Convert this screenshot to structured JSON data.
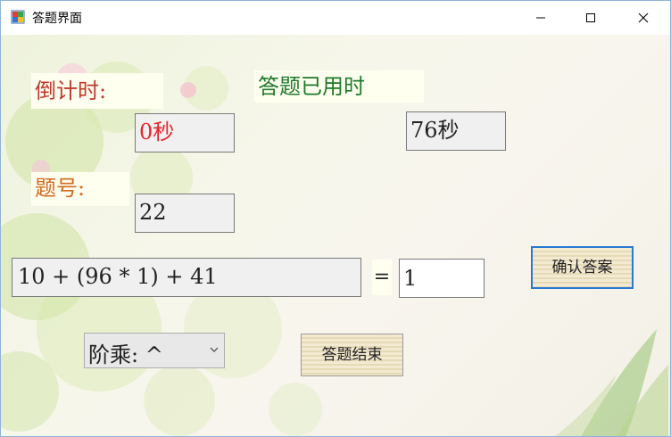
{
  "window": {
    "title": "答题界面",
    "controls": {
      "minimize": "minimize-icon",
      "maximize": "maximize-icon",
      "close": "close-icon"
    }
  },
  "countdown": {
    "label": "倒计时:",
    "value": "0秒",
    "value_color": "#e8242b"
  },
  "elapsed": {
    "label": "答题已用时",
    "value": "76秒"
  },
  "question_number": {
    "label": "题号:",
    "value": "22"
  },
  "question": {
    "expression": "10 + (96 * 1) + 41",
    "equals": "=",
    "answer": "1"
  },
  "buttons": {
    "confirm": "确认答案",
    "finish": "答题结束"
  },
  "operator_select": {
    "selected": "阶乘: ^"
  },
  "colors": {
    "title_countdown": "#c0392b",
    "title_elapsed": "#1e7a2a",
    "title_qnum": "#d2691e",
    "focus_border": "#2a78d4"
  }
}
